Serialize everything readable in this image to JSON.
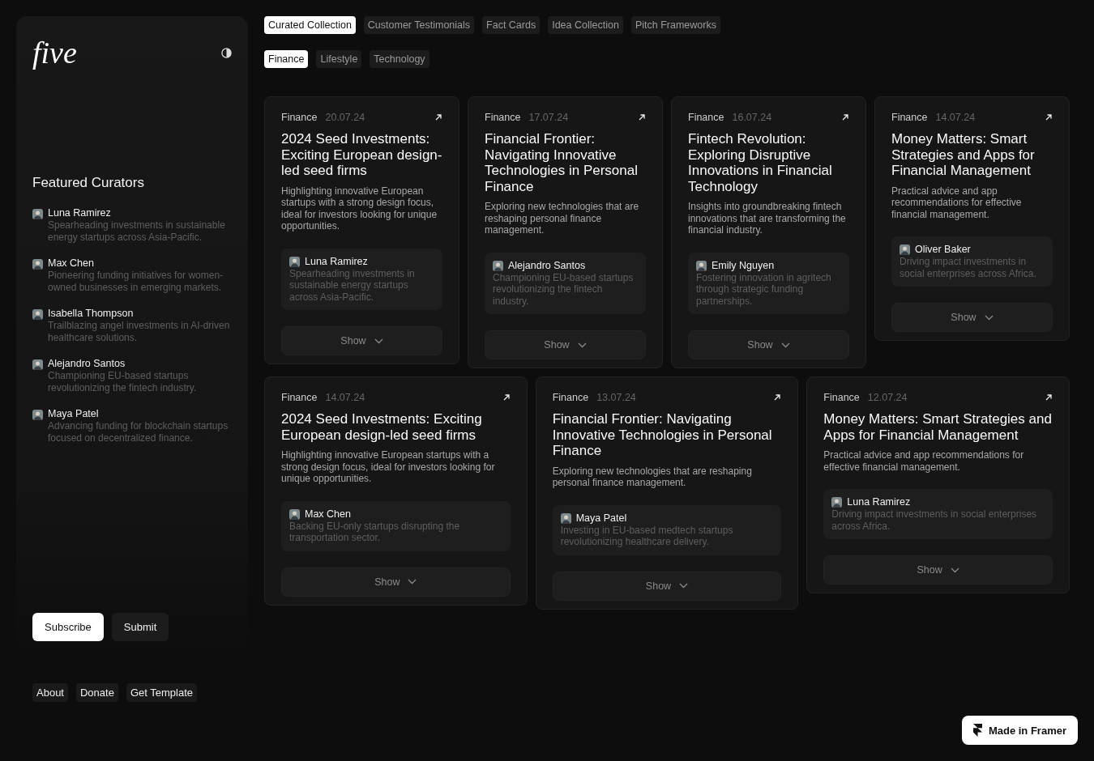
{
  "logo": "five",
  "collections": [
    {
      "label": "Curated Collection",
      "selected": true
    },
    {
      "label": "Customer Testimonials",
      "selected": false
    },
    {
      "label": "Fact Cards",
      "selected": false
    },
    {
      "label": "Idea Collection",
      "selected": false
    },
    {
      "label": "Pitch Frameworks",
      "selected": false
    }
  ],
  "filters": [
    {
      "label": "Finance",
      "selected": true
    },
    {
      "label": "Lifestyle",
      "selected": false
    },
    {
      "label": "Technology",
      "selected": false
    }
  ],
  "featured_title": "Featured Curators",
  "curators": [
    {
      "name": "Luna Ramirez",
      "bio": "Spearheading investments in sustainable energy startups across Asia-Pacific."
    },
    {
      "name": "Max Chen",
      "bio": "Pioneering funding initiatives for women-owned businesses in emerging markets."
    },
    {
      "name": "Isabella Thompson",
      "bio": "Trailblazing angel investments in AI-driven healthcare solutions."
    },
    {
      "name": "Alejandro Santos",
      "bio": "Championing EU-based startups revolutionizing the fintech industry."
    },
    {
      "name": "Maya Patel",
      "bio": "Advancing funding for blockchain startups focused on decentralized finance."
    }
  ],
  "actions": [
    {
      "label": "Subscribe",
      "kind": "primary"
    },
    {
      "label": "Submit",
      "kind": "secondary"
    }
  ],
  "footer_links": [
    "About",
    "Donate",
    "Get Template"
  ],
  "card_rows": [
    [
      {
        "category": "Finance",
        "date": "20.07.24",
        "title": "2024 Seed Investments: Exciting European design-led seed firms",
        "description": "Highlighting innovative European startups with a strong design focus, ideal for investors looking for unique opportunities.",
        "curator": {
          "name": "Luna Ramirez",
          "bio": "Spearheading investments in sustainable energy startups across Asia-Pacific."
        },
        "button": "Show"
      },
      {
        "category": "Finance",
        "date": "17.07.24",
        "title": "Financial Frontier: Navigating Innovative Technologies in Personal Finance",
        "description": "Exploring new technologies that are reshaping personal finance management.",
        "curator": {
          "name": "Alejandro Santos",
          "bio": "Championing EU-based startups revolutionizing the fintech industry."
        },
        "button": "Show"
      },
      {
        "category": "Finance",
        "date": "16.07.24",
        "title": "Fintech Revolution: Exploring Disruptive Innovations in Financial Technology",
        "description": "Insights into groundbreaking fintech innovations that are transforming the financial industry.",
        "curator": {
          "name": "Emily Nguyen",
          "bio": "Fostering innovation in agritech through strategic funding partnerships."
        },
        "button": "Show"
      },
      {
        "category": "Finance",
        "date": "14.07.24",
        "title": "Money Matters: Smart Strategies and Apps for Financial Management",
        "description": "Practical advice and app recommendations for effective financial management.",
        "curator": {
          "name": "Oliver Baker",
          "bio": "Driving impact investments in social enterprises across Africa."
        },
        "button": "Show"
      }
    ],
    [
      {
        "category": "Finance",
        "date": "14.07.24",
        "title": "2024 Seed Investments: Exciting European design-led seed firms",
        "description": "Highlighting innovative European startups with a strong design focus, ideal for investors looking for unique opportunities.",
        "curator": {
          "name": "Max Chen",
          "bio": "Backing EU-only startups disrupting the transportation sector."
        },
        "button": "Show"
      },
      {
        "category": "Finance",
        "date": "13.07.24",
        "title": "Financial Frontier: Navigating Innovative Technologies in Personal Finance",
        "description": "Exploring new technologies that are reshaping personal finance management.",
        "curator": {
          "name": "Maya Patel",
          "bio": "Investing in EU-based medtech startups revolutionizing healthcare delivery."
        },
        "button": "Show"
      },
      {
        "category": "Finance",
        "date": "12.07.24",
        "title": "Money Matters: Smart Strategies and Apps for Financial Management",
        "description": "Practical advice and app recommendations for effective financial management.",
        "curator": {
          "name": "Luna Ramirez",
          "bio": "Driving impact investments in social enterprises across Africa."
        },
        "button": "Show"
      }
    ]
  ],
  "badge": "Made in Framer"
}
